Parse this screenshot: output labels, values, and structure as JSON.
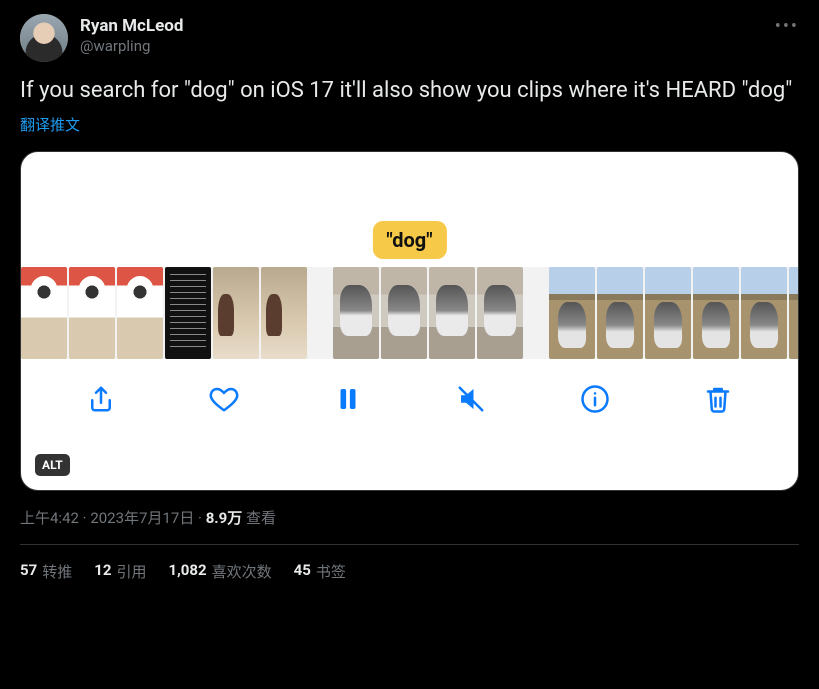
{
  "author": {
    "display_name": "Ryan McLeod",
    "handle": "@warpling"
  },
  "tweet_text": "If you search for \"dog\" on iOS 17 it'll also show you clips where it's HEARD \"dog\"",
  "translate_label": "翻译推文",
  "media": {
    "caption_bubble": "\"dog\"",
    "alt_badge": "ALT"
  },
  "meta": {
    "time": "上午4:42",
    "separator1": " · ",
    "date": "2023年7月17日",
    "separator2": " · ",
    "views_number": "8.9万",
    "views_label": " 查看"
  },
  "stats": {
    "retweets": {
      "count": "57",
      "label": "转推"
    },
    "quotes": {
      "count": "12",
      "label": "引用"
    },
    "likes": {
      "count": "1,082",
      "label": "喜欢次数"
    },
    "bookmarks": {
      "count": "45",
      "label": "书签"
    }
  }
}
